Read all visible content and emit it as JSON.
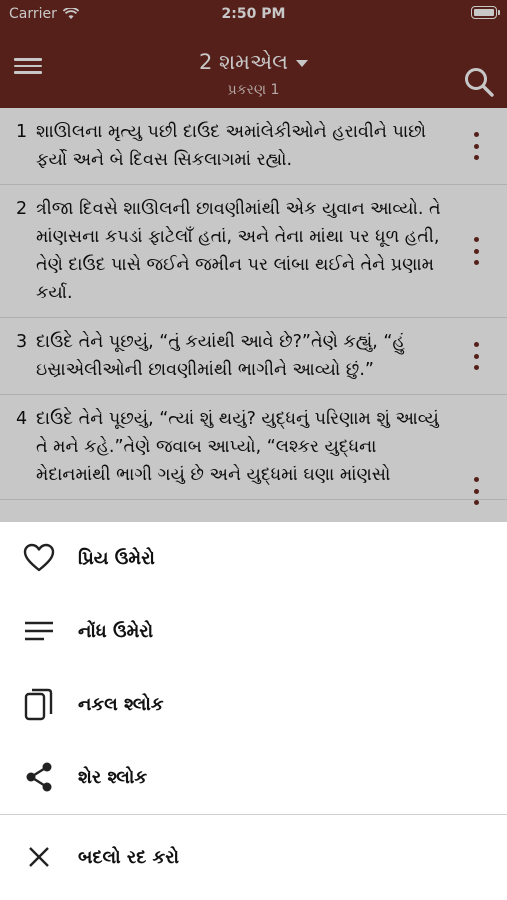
{
  "status": {
    "carrier": "Carrier",
    "time": "2:50 PM",
    "battery_level": 1.0
  },
  "nav": {
    "book": "2 શમએલ",
    "chapter": "પ્રકરણ 1"
  },
  "verses": [
    {
      "num": "1",
      "text": "શાઊલના મૃત્યુ પછી દાઉદ અમાંલેકીઓને હરાવીને પાછો ફર્યો અને બે દિવસ સિકલાગમાં રહ્યો."
    },
    {
      "num": "2",
      "text": "ત્રીજા દિવસે શાઊલની છાવણીમાંથી એક યુવાન આવ્યો. તે માંણસના કપડાં ફાટેલાઁ હતાં, અને તેના માંથા પર ધૂળ હતી, તેણે દાઉદ પાસે જઈને જમીન પર લાંબા થઈને તેને પ્રણામ કર્યા."
    },
    {
      "num": "3",
      "text": "દાઉદે તેને પૂછયું, “તું કયાંથી આવે છે?”તેણે કહ્યું, “હું ઇસ્રાએલીઓની છાવણીમાંથી ભાગીને આવ્યો છું.”"
    },
    {
      "num": "4",
      "text": "દાઉદે તેને પૂછયું, “ત્યાં શું થયું? યુદ્ધનું પરિણામ શું આવ્યું તે મને કહે.”તેણે જવાબ આપ્યો, “લશ્કર યુદ્ધના મેદાનમાંથી ભાગી ગયું છે અને યુદ્ધમાં ઘણા માંણસો"
    }
  ],
  "actions": {
    "favorite": "પ્રિય ઉમેરો",
    "note": "નોંધ ઉમેરો",
    "copy": "નકલ શ્લોક",
    "share": "શેર શ્લોક",
    "cancel": "બદલો રદ કરો"
  }
}
